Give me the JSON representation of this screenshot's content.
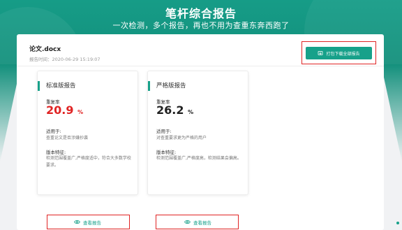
{
  "hero": {
    "title": "笔杆综合报告",
    "subtitle": "一次检测，多个报告，再也不用为查重东奔西跑了"
  },
  "file": {
    "name": "论文.docx",
    "time": "报告时间：2020-06-29 15:19:07"
  },
  "download": {
    "label": "打包下载全部报告",
    "icon": "package-download-icon"
  },
  "cards": [
    {
      "title": "标准版报告",
      "rate_label": "重复率",
      "rate_value": "20.9",
      "rate_unit": "%",
      "for_label": "适用于:",
      "for_text": "查重论文是否涉嫌抄袭",
      "feature_label": "版本特征:",
      "feature_text": "检测范围覆盖广,严格度适中，符合大多数学校要求。",
      "view_label": "查看报告",
      "rate_color": "#e02424"
    },
    {
      "title": "严格版报告",
      "rate_label": "重复率",
      "rate_value": "26.2",
      "rate_unit": "%",
      "for_label": "适用于:",
      "for_text": "对查重要求更为严格的用户",
      "feature_label": "版本特征:",
      "feature_text": "检测范围覆盖广,严格度高，检测结果会偏高。",
      "view_label": "查看报告",
      "rate_color": "#222222"
    }
  ],
  "colors": {
    "brand": "#17a18a",
    "highlight": "#e02424"
  }
}
